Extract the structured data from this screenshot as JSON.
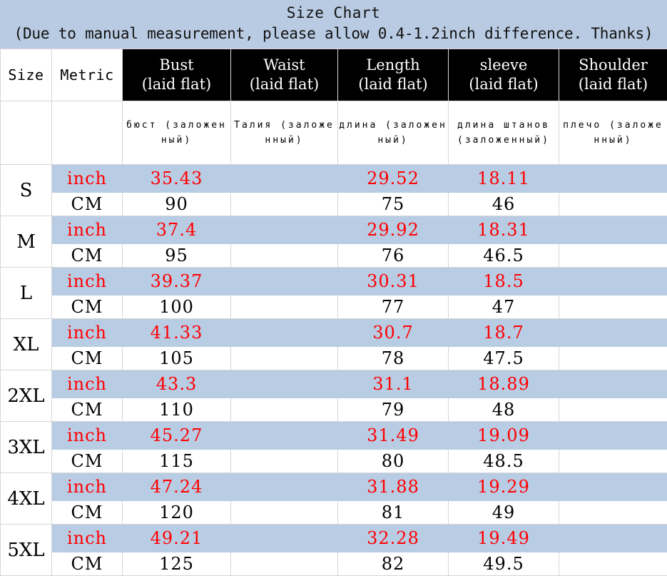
{
  "header": {
    "title": "Size Chart",
    "subtitle": "(Due to manual measurement, please allow 0.4-1.2inch difference. Thanks)",
    "title_bg": "#b9cbe2"
  },
  "table": {
    "columns": [
      {
        "key": "size",
        "label_line1": "Size",
        "label_line2": "",
        "russian": "",
        "style": "plain"
      },
      {
        "key": "metric",
        "label_line1": "Metric",
        "label_line2": "",
        "russian": "",
        "style": "plain"
      },
      {
        "key": "bust",
        "label_line1": "Bust",
        "label_line2": "(laid flat)",
        "russian": "бюст (заложенный)",
        "style": "dark"
      },
      {
        "key": "waist",
        "label_line1": "Waist",
        "label_line2": "(laid flat)",
        "russian": "Талия (заложенный)",
        "style": "dark"
      },
      {
        "key": "length",
        "label_line1": "Length",
        "label_line2": "(laid flat)",
        "russian": "длина (заложенный)",
        "style": "dark"
      },
      {
        "key": "sleeve",
        "label_line1": "sleeve",
        "label_line2": "(laid flat)",
        "russian": "длина штанов (заложенный)",
        "style": "dark"
      },
      {
        "key": "shoulder",
        "label_line1": "Shoulder",
        "label_line2": "(laid flat)",
        "russian": "плечо (заложенный)",
        "style": "dark"
      }
    ],
    "metric_labels": {
      "inch": "inch",
      "cm": "CM"
    },
    "colors": {
      "inch_row_bg": "#b8cce4",
      "inch_text": "#ff0000",
      "cm_row_bg": "#ffffff",
      "cm_text": "#000000",
      "header_dark_bg": "#000000",
      "header_dark_text": "#ffffff"
    },
    "rows": [
      {
        "size": "S",
        "inch": {
          "bust": "35.43",
          "waist": "",
          "length": "29.52",
          "sleeve": "18.11",
          "shoulder": ""
        },
        "cm": {
          "bust": "90",
          "waist": "",
          "length": "75",
          "sleeve": "46",
          "shoulder": ""
        }
      },
      {
        "size": "M",
        "inch": {
          "bust": "37.4",
          "waist": "",
          "length": "29.92",
          "sleeve": "18.31",
          "shoulder": ""
        },
        "cm": {
          "bust": "95",
          "waist": "",
          "length": "76",
          "sleeve": "46.5",
          "shoulder": ""
        }
      },
      {
        "size": "L",
        "inch": {
          "bust": "39.37",
          "waist": "",
          "length": "30.31",
          "sleeve": "18.5",
          "shoulder": ""
        },
        "cm": {
          "bust": "100",
          "waist": "",
          "length": "77",
          "sleeve": "47",
          "shoulder": ""
        }
      },
      {
        "size": "XL",
        "inch": {
          "bust": "41.33",
          "waist": "",
          "length": "30.7",
          "sleeve": "18.7",
          "shoulder": ""
        },
        "cm": {
          "bust": "105",
          "waist": "",
          "length": "78",
          "sleeve": "47.5",
          "shoulder": ""
        }
      },
      {
        "size": "2XL",
        "inch": {
          "bust": "43.3",
          "waist": "",
          "length": "31.1",
          "sleeve": "18.89",
          "shoulder": ""
        },
        "cm": {
          "bust": "110",
          "waist": "",
          "length": "79",
          "sleeve": "48",
          "shoulder": ""
        }
      },
      {
        "size": "3XL",
        "inch": {
          "bust": "45.27",
          "waist": "",
          "length": "31.49",
          "sleeve": "19.09",
          "shoulder": ""
        },
        "cm": {
          "bust": "115",
          "waist": "",
          "length": "80",
          "sleeve": "48.5",
          "shoulder": ""
        }
      },
      {
        "size": "4XL",
        "inch": {
          "bust": "47.24",
          "waist": "",
          "length": "31.88",
          "sleeve": "19.29",
          "shoulder": ""
        },
        "cm": {
          "bust": "120",
          "waist": "",
          "length": "81",
          "sleeve": "49",
          "shoulder": ""
        }
      },
      {
        "size": "5XL",
        "inch": {
          "bust": "49.21",
          "waist": "",
          "length": "32.28",
          "sleeve": "19.49",
          "shoulder": ""
        },
        "cm": {
          "bust": "125",
          "waist": "",
          "length": "82",
          "sleeve": "49.5",
          "shoulder": ""
        }
      }
    ]
  }
}
